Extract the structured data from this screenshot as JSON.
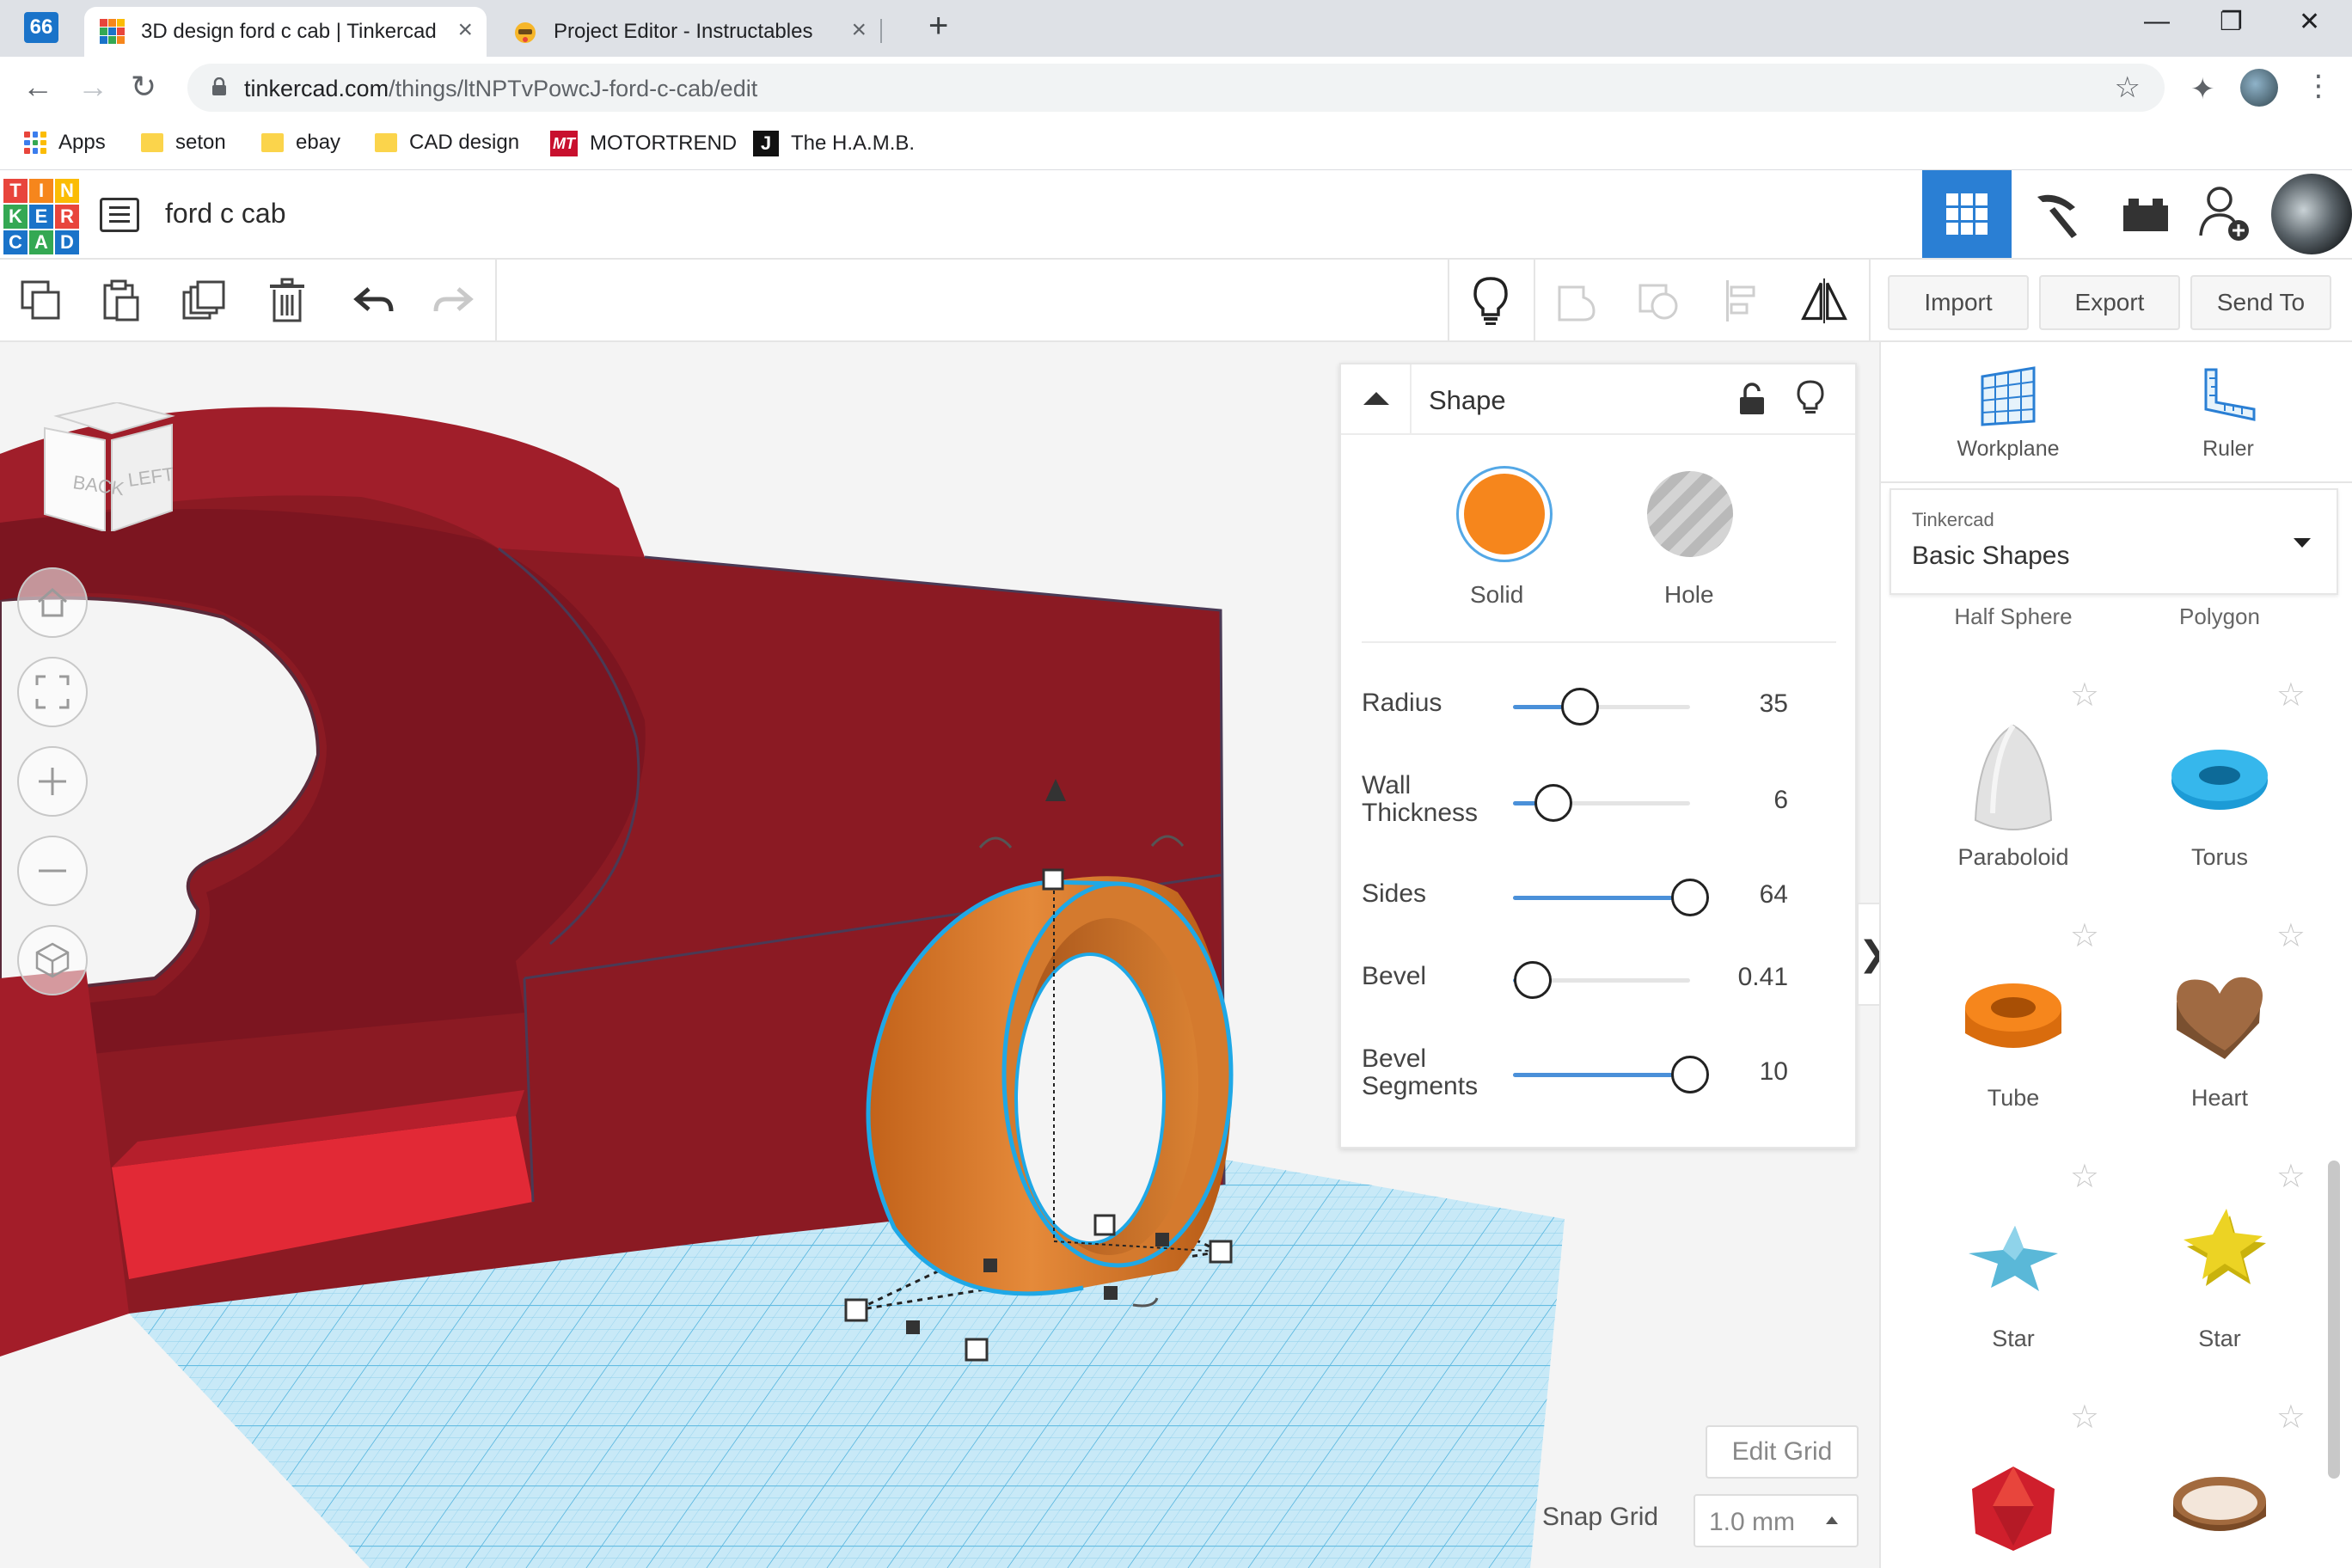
{
  "browser": {
    "extension_badge": "66",
    "tabs": [
      {
        "title": "3D design ford c cab | Tinkercad",
        "active": true
      },
      {
        "title": "Project Editor - Instructables",
        "active": false
      }
    ],
    "new_tab": "+",
    "window_controls": {
      "minimize": "—",
      "restore": "❐",
      "close": "✕"
    },
    "url": {
      "host": "tinkercad.com",
      "path": "/things/ltNPTvPowcJ-ford-c-cab/edit"
    },
    "bookmarks": [
      {
        "label": "Apps",
        "icon": "apps-grid-icon"
      },
      {
        "label": "seton",
        "icon": "folder-icon"
      },
      {
        "label": "ebay",
        "icon": "folder-icon"
      },
      {
        "label": "CAD design",
        "icon": "folder-icon"
      },
      {
        "label": "MOTORTREND",
        "icon": "motortrend-icon",
        "badge": "MT"
      },
      {
        "label": "The H.A.M.B.",
        "icon": "hamb-icon",
        "badge": "J"
      }
    ]
  },
  "app": {
    "logo_letters": [
      "T",
      "I",
      "N",
      "K",
      "E",
      "R",
      "C",
      "A",
      "D"
    ],
    "design_title": "ford c cab",
    "header_buttons": [
      "3d-design-view",
      "build-view",
      "bricks-view",
      "invite-user"
    ]
  },
  "toolbar": {
    "actions": {
      "import": "Import",
      "export": "Export",
      "send_to": "Send To"
    }
  },
  "inspector": {
    "title": "Shape",
    "solid_label": "Solid",
    "hole_label": "Hole",
    "properties": [
      {
        "label": "Radius",
        "value": "35",
        "fill": 0.38
      },
      {
        "label": "Wall Thickness",
        "value": "6",
        "fill": 0.23
      },
      {
        "label": "Sides",
        "value": "64",
        "fill": 1.0
      },
      {
        "label": "Bevel",
        "value": "0.41",
        "fill": 0.11
      },
      {
        "label": "Bevel Segments",
        "value": "10",
        "fill": 1.0
      }
    ]
  },
  "viewcube": {
    "back": "BACK",
    "left": "LEFT"
  },
  "grid": {
    "edit_grid": "Edit Grid",
    "snap_label": "Snap Grid",
    "snap_value": "1.0 mm"
  },
  "right_panel": {
    "workplane": "Workplane",
    "ruler": "Ruler",
    "library_source": "Tinkercad",
    "library_name": "Basic Shapes",
    "partial_shapes": [
      "Half Sphere",
      "Polygon"
    ],
    "shapes": [
      "Paraboloid",
      "Torus",
      "Tube",
      "Heart",
      "Star",
      "Star"
    ]
  },
  "colors": {
    "accent": "#2a7fd4",
    "solid": "#f6861c",
    "model_red": "#8b1a23",
    "selection": "#1fa8e6"
  }
}
